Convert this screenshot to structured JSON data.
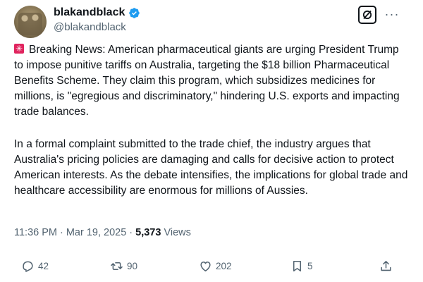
{
  "user": {
    "display_name": "blakandblack",
    "handle": "@blakandblack"
  },
  "icons": {
    "verified": "verified-badge-icon",
    "grok": "grok-icon",
    "more": "more-icon",
    "siren": "siren-emoji-icon",
    "reply": "reply-icon",
    "repost": "repost-icon",
    "like": "heart-icon",
    "bookmark": "bookmark-icon",
    "share": "share-icon"
  },
  "colors": {
    "verified": "#1d9bf0",
    "text": "#0f1419",
    "secondary": "#536471",
    "siren": "#e0245e"
  },
  "tweet": {
    "paragraph_1": "Breaking News: American pharmaceutical giants are urging President Trump to impose punitive tariffs on Australia, targeting the $18 billion Pharmaceutical Benefits Scheme. They claim this program, which subsidizes medicines for millions, is \"egregious and discriminatory,\" hindering U.S. exports and impacting trade balances.",
    "paragraph_2": "In a formal complaint submitted to the trade chief, the industry argues that Australia's pricing policies are damaging and calls for decisive action to protect American interests. As the debate intensifies, the implications for global trade and healthcare accessibility are enormous for millions of Aussies."
  },
  "meta": {
    "time": "11:36 PM",
    "separator": "·",
    "date": "Mar 19, 2025",
    "views_count": "5,373",
    "views_label": "Views"
  },
  "actions": {
    "replies": "42",
    "reposts": "90",
    "likes": "202",
    "bookmarks": "5"
  }
}
